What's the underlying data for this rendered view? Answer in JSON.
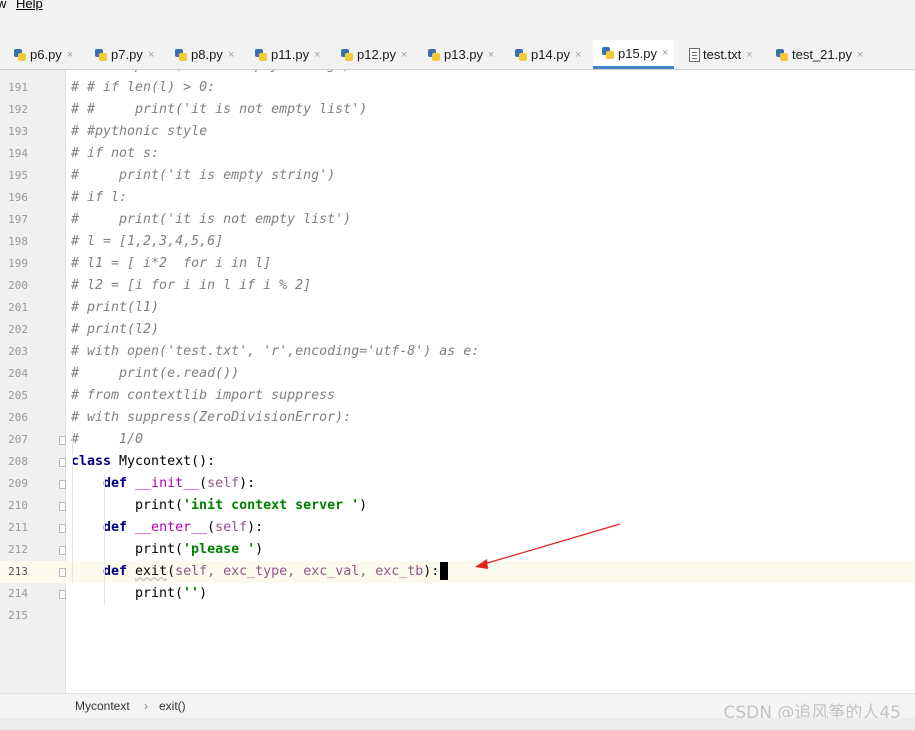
{
  "menu": {
    "partial_item": "w",
    "help": "Help"
  },
  "tabs": [
    {
      "label": "p6.py",
      "icon": "python-file-icon"
    },
    {
      "label": "p7.py",
      "icon": "python-file-icon"
    },
    {
      "label": "p8.py",
      "icon": "python-file-icon"
    },
    {
      "label": "p11.py",
      "icon": "python-file-icon"
    },
    {
      "label": "p12.py",
      "icon": "python-file-icon"
    },
    {
      "label": "p13.py",
      "icon": "python-file-icon"
    },
    {
      "label": "p14.py",
      "icon": "python-file-icon"
    },
    {
      "label": "p15.py",
      "icon": "python-file-icon",
      "active": true
    },
    {
      "label": "test.txt",
      "icon": "text-file-icon"
    },
    {
      "label": "test_21.py",
      "icon": "python-file-icon"
    }
  ],
  "close_glyph": "×",
  "editor": {
    "partial_top": "# #     print('it is empty string')",
    "lines": [
      {
        "n": "191",
        "text": "# # if len(l) > 0:"
      },
      {
        "n": "192",
        "text": "# #     print('it is not empty list')"
      },
      {
        "n": "193",
        "text": "# #pythonic style"
      },
      {
        "n": "194",
        "text": "# if not s:"
      },
      {
        "n": "195",
        "text": "#     print('it is empty string')"
      },
      {
        "n": "196",
        "text": "# if l:"
      },
      {
        "n": "197",
        "text": "#     print('it is not empty list')"
      },
      {
        "n": "198",
        "text": "# l = [1,2,3,4,5,6]"
      },
      {
        "n": "199",
        "text": "# l1 = [ i*2  for i in l]"
      },
      {
        "n": "200",
        "text": "# l2 = [i for i in l if i % 2]"
      },
      {
        "n": "201",
        "text": "# print(l1)"
      },
      {
        "n": "202",
        "text": "# print(l2)"
      },
      {
        "n": "203",
        "text": "# with open('test.txt', 'r',encoding='utf-8') as e:"
      },
      {
        "n": "204",
        "text": "#     print(e.read())"
      },
      {
        "n": "205",
        "text": "# from contextlib import suppress"
      },
      {
        "n": "206",
        "text": "# with suppress(ZeroDivisionError):"
      },
      {
        "n": "207",
        "text": "#     1/0"
      },
      {
        "n": "208",
        "kw": "class",
        "rest": " Mycontext():"
      },
      {
        "n": "209",
        "kw": "def",
        "fn": "__init__",
        "open": "(",
        "self": "self",
        "close": "):"
      },
      {
        "n": "210",
        "call": "print(",
        "str": "'init context server '",
        "end": ")"
      },
      {
        "n": "211",
        "kw": "def",
        "fn": "__enter__",
        "open": "(",
        "self": "self",
        "close": "):"
      },
      {
        "n": "212",
        "call": "print(",
        "str": "'please '",
        "end": ")"
      },
      {
        "n": "213",
        "kw": "def",
        "name": "exit",
        "open": "(",
        "self": "self",
        "params": ", exc_type, exc_val, exc_tb",
        "close": "):"
      },
      {
        "n": "214",
        "call": "print(",
        "str": "''",
        "end": ")"
      },
      {
        "n": "215",
        "text": ""
      }
    ]
  },
  "breadcrumb": {
    "first": "Mycontext",
    "separator": "›",
    "second": "exit()"
  },
  "watermark": "CSDN @追风筝的人45",
  "colors": {
    "tab_active_underline": "#4083c9",
    "annotation_arrow": "#e02020",
    "current_line": "#fcfaed"
  }
}
